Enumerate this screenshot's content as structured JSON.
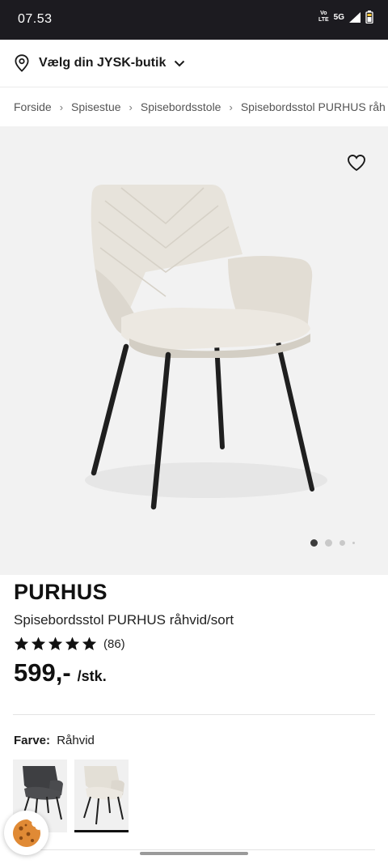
{
  "status_bar": {
    "time": "07.53",
    "volte_line1": "Vo",
    "volte_line2": "LTE",
    "network": "5G"
  },
  "store_selector": {
    "label": "Vælg din JYSK-butik",
    "icons": [
      "location-pin-icon",
      "chevron-down-icon"
    ]
  },
  "breadcrumb": [
    "Forside",
    "Spisestue",
    "Spisebordsstole",
    "Spisebordsstol PURHUS råh"
  ],
  "gallery": {
    "icons": [
      "heart-icon"
    ],
    "image_count": 4,
    "active_image": 1
  },
  "product": {
    "brand": "PURHUS",
    "name": "Spisebordsstol PURHUS råhvid/sort",
    "rating": 5,
    "rating_count": "(86)",
    "price": "599,-",
    "unit": "/stk."
  },
  "color": {
    "label": "Farve:",
    "value": "Råhvid",
    "options": [
      {
        "name": "dark-grey",
        "color": "#3e3f42",
        "selected": false
      },
      {
        "name": "off-white",
        "color": "#e7e3db",
        "selected": true
      }
    ]
  },
  "colors": {
    "status_bar_bg": "#1c1b20",
    "text": "#1a1a1a",
    "gallery_bg": "#f2f2f2",
    "chair_fabric": "#e7e3db",
    "chair_legs": "#1f1f1f",
    "cookie": "#e08a35"
  }
}
